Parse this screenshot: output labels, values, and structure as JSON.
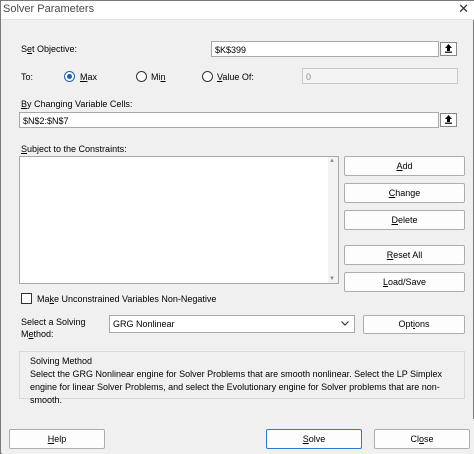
{
  "window": {
    "title": "Solver Parameters",
    "close_glyph": "✕"
  },
  "objective": {
    "label_pre": "S",
    "label_ul": "e",
    "label_post": "t Objective:",
    "value": "$K$399"
  },
  "to": {
    "label": "To:",
    "options": [
      {
        "pre": "",
        "ul": "M",
        "post": "ax",
        "checked": true
      },
      {
        "pre": "Mi",
        "ul": "n",
        "post": "",
        "checked": false
      },
      {
        "pre": "",
        "ul": "V",
        "post": "alue Of:",
        "checked": false
      }
    ],
    "value_of": "0"
  },
  "changing": {
    "label_pre": "",
    "label_ul": "B",
    "label_post": "y Changing Variable Cells:",
    "value": "$N$2:$N$7"
  },
  "constraints": {
    "label_pre": "",
    "label_ul": "S",
    "label_post": "ubject to the Constraints:"
  },
  "side_buttons": [
    {
      "pre": "",
      "ul": "A",
      "post": "dd"
    },
    {
      "pre": "",
      "ul": "C",
      "post": "hange"
    },
    {
      "pre": "",
      "ul": "D",
      "post": "elete"
    },
    {
      "pre": "",
      "ul": "R",
      "post": "eset All"
    },
    {
      "pre": "",
      "ul": "L",
      "post": "oad/Save"
    }
  ],
  "nonneg": {
    "pre": "Ma",
    "ul": "k",
    "post": "e Unconstrained Variables Non-Negative",
    "checked": false
  },
  "method": {
    "label_line1": "Select a Solving",
    "label_line2_pre": "M",
    "label_line2_ul": "e",
    "label_line2_post": "thod:",
    "selected": "GRG Nonlinear",
    "options_button_pre": "Opt",
    "options_button_ul": "i",
    "options_button_post": "ons"
  },
  "solving_method": {
    "title": "Solving Method",
    "text": "Select the GRG Nonlinear engine for Solver Problems that are smooth nonlinear. Select the LP Simplex engine for linear Solver Problems, and select the Evolutionary engine for Solver problems that are non-smooth."
  },
  "bottom": {
    "help": {
      "pre": "",
      "ul": "H",
      "post": "elp"
    },
    "solve": {
      "pre": "",
      "ul": "S",
      "post": "olve"
    },
    "close": {
      "pre": "Cl",
      "ul": "o",
      "post": "se"
    }
  },
  "icons": {
    "ref": "collapse-dialog-icon",
    "scroll_up": "scroll-up-icon",
    "scroll_down": "scroll-down-icon",
    "dropdown": "chevron-down-icon"
  },
  "colors": {
    "accent": "#1a5fb4",
    "default_button_border": "#2a7bd4"
  }
}
